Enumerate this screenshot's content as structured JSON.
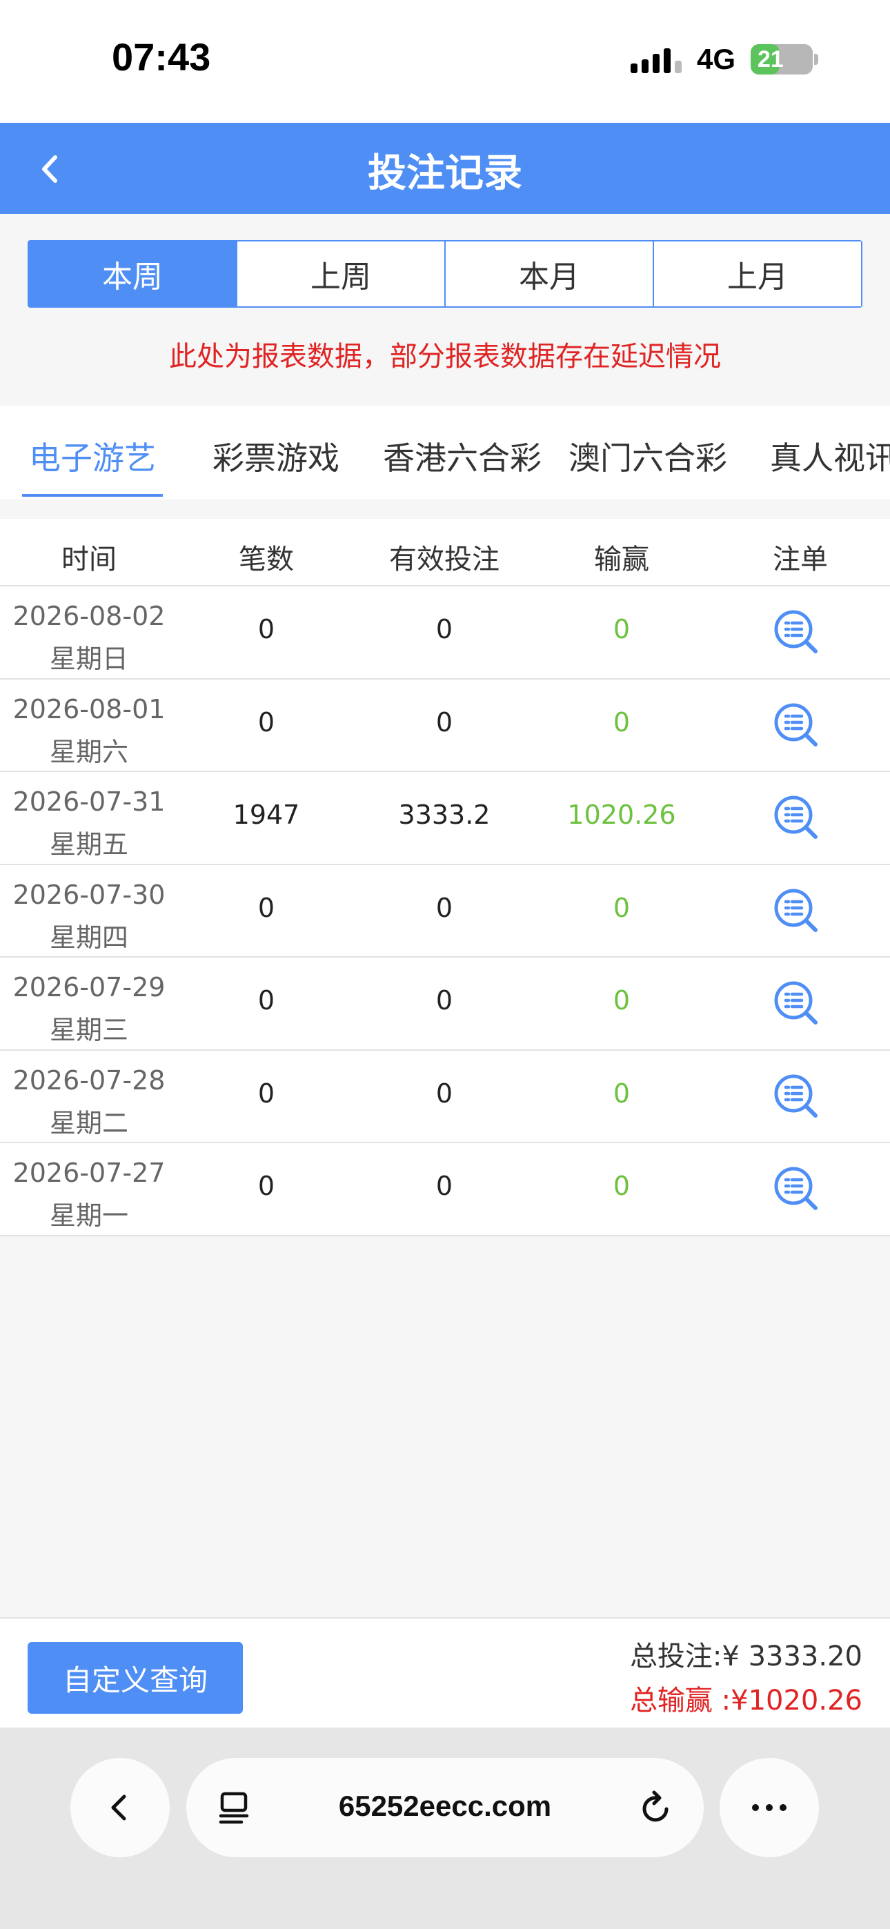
{
  "status_bar": {
    "time": "07:43",
    "network": "4G",
    "battery": "21",
    "battery_level": 0.21
  },
  "header": {
    "title": "投注记录"
  },
  "period_tabs": [
    {
      "label": "本周",
      "active": true
    },
    {
      "label": "上周",
      "active": false
    },
    {
      "label": "本月",
      "active": false
    },
    {
      "label": "上月",
      "active": false
    }
  ],
  "notice": "此处为报表数据，部分报表数据存在延迟情况",
  "categories": [
    {
      "label": "电子游艺",
      "active": true
    },
    {
      "label": "彩票游戏",
      "active": false
    },
    {
      "label": "香港六合彩",
      "active": false
    },
    {
      "label": "澳门六合彩",
      "active": false
    },
    {
      "label": "真人视讯",
      "active": false
    }
  ],
  "table": {
    "headers": [
      "时间",
      "笔数",
      "有效投注",
      "输赢",
      "注单"
    ],
    "rows": [
      {
        "date": "2026-08-02",
        "weekday": "星期日",
        "count": "0",
        "valid_bet": "0",
        "win_loss": "0"
      },
      {
        "date": "2026-08-01",
        "weekday": "星期六",
        "count": "0",
        "valid_bet": "0",
        "win_loss": "0"
      },
      {
        "date": "2026-07-31",
        "weekday": "星期五",
        "count": "1947",
        "valid_bet": "3333.2",
        "win_loss": "1020.26"
      },
      {
        "date": "2026-07-30",
        "weekday": "星期四",
        "count": "0",
        "valid_bet": "0",
        "win_loss": "0"
      },
      {
        "date": "2026-07-29",
        "weekday": "星期三",
        "count": "0",
        "valid_bet": "0",
        "win_loss": "0"
      },
      {
        "date": "2026-07-28",
        "weekday": "星期二",
        "count": "0",
        "valid_bet": "0",
        "win_loss": "0"
      },
      {
        "date": "2026-07-27",
        "weekday": "星期一",
        "count": "0",
        "valid_bet": "0",
        "win_loss": "0"
      }
    ],
    "detail_icon": "search-list-icon"
  },
  "summary": {
    "query_button": "自定义查询",
    "total_bet": "总投注:¥ 3333.20",
    "total_win": "总输赢 :¥1020.26"
  },
  "browser": {
    "url": "65252eecc.com"
  },
  "colors": {
    "primary": "#4f8ff5",
    "red": "#e02424",
    "green": "#6cc13e"
  }
}
